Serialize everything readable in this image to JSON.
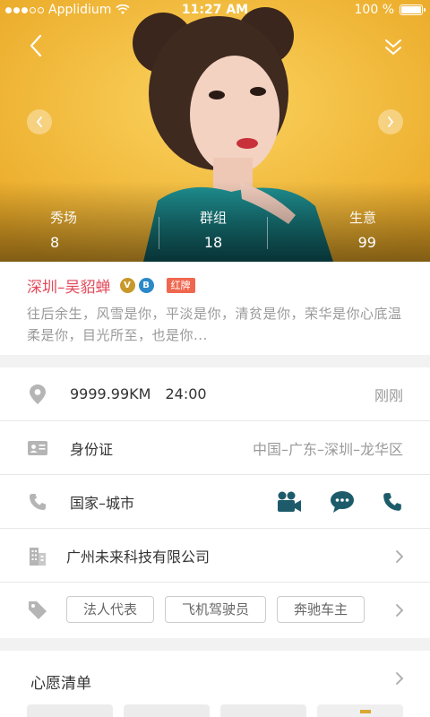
{
  "status_bar": {
    "carrier": "Applidium",
    "time": "11:27 AM",
    "battery": "100 %",
    "battery_level": 1.0,
    "signal_bars_filled": 3,
    "signal_bars_total": 5
  },
  "hero": {
    "back_icon": "chevron-left-icon",
    "collapse_icon": "double-chevron-down-icon",
    "prev_icon": "chevron-left-icon",
    "next_icon": "chevron-right-icon",
    "stats": [
      {
        "label": "秀场",
        "value": "8"
      },
      {
        "label": "群组",
        "value": "18"
      },
      {
        "label": "生意",
        "value": "99"
      }
    ]
  },
  "profile": {
    "name": "深圳–吴貂蝉",
    "badge_v": "V",
    "badge_b": "B",
    "tag": "红牌",
    "bio": "往后余生，风雪是你，平淡是你，清贫是你，荣华是你心底温柔是你，目光所至，也是你..."
  },
  "info": {
    "location": {
      "icon": "location-pin-icon",
      "distance": "9999.99KM",
      "time": "24:00",
      "status": "刚刚"
    },
    "id_card": {
      "icon": "id-card-icon",
      "label": "身份证",
      "value": "中国–广东–深圳–龙华区"
    },
    "contact": {
      "icon": "phone-icon",
      "label": "国家–城市",
      "actions": [
        "video-call-icon",
        "chat-icon",
        "phone-call-icon"
      ]
    },
    "company": {
      "icon": "building-icon",
      "label": "广州未来科技有限公司"
    },
    "tags": {
      "icon": "tag-icon",
      "items": [
        "法人代表",
        "飞机驾驶员",
        "奔驰车主"
      ]
    }
  },
  "wishlist": {
    "title": "心愿清单"
  },
  "colors": {
    "accent_name": "#e24a5b",
    "action_teal": "#1d5b6b",
    "badge_gold": "#c8992a",
    "badge_blue": "#2b89c8",
    "tag_red": "#f0674f",
    "hero_yellow": "#f3b733"
  }
}
